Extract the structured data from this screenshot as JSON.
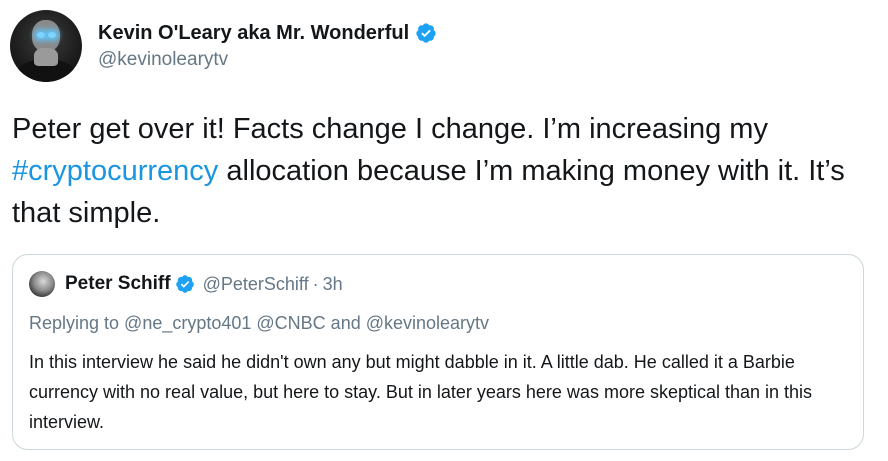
{
  "tweet": {
    "display_name": "Kevin O'Leary aka Mr. Wonderful",
    "handle": "@kevinolearytv",
    "text_before": "Peter get over it! Facts change I change. I’m increasing my ",
    "hashtag": "#cryptocurrency",
    "text_after": " allocation because I’m making money with it. It’s that simple.",
    "avatar_icon": "user-avatar-icon",
    "verified_icon": "verified-badge-icon"
  },
  "quoted_tweet": {
    "display_name": "Peter Schiff",
    "handle": "@PeterSchiff",
    "separator": "·",
    "time": "3h",
    "replying_to": "Replying to @ne_crypto401 @CNBC and @kevinolearytv",
    "text": "In this interview he said he didn't own any but might dabble in it. A little dab. He called it a Barbie currency with no real value, but here to stay. But in later years here was more skeptical than in this interview.",
    "avatar_icon": "user-avatar-icon",
    "verified_icon": "verified-badge-icon"
  },
  "colors": {
    "verified": "#1da1f2",
    "hashtag": "#1b95e0",
    "secondary_text": "#657786",
    "primary_text": "#14171a",
    "border": "#ccd6dd"
  }
}
